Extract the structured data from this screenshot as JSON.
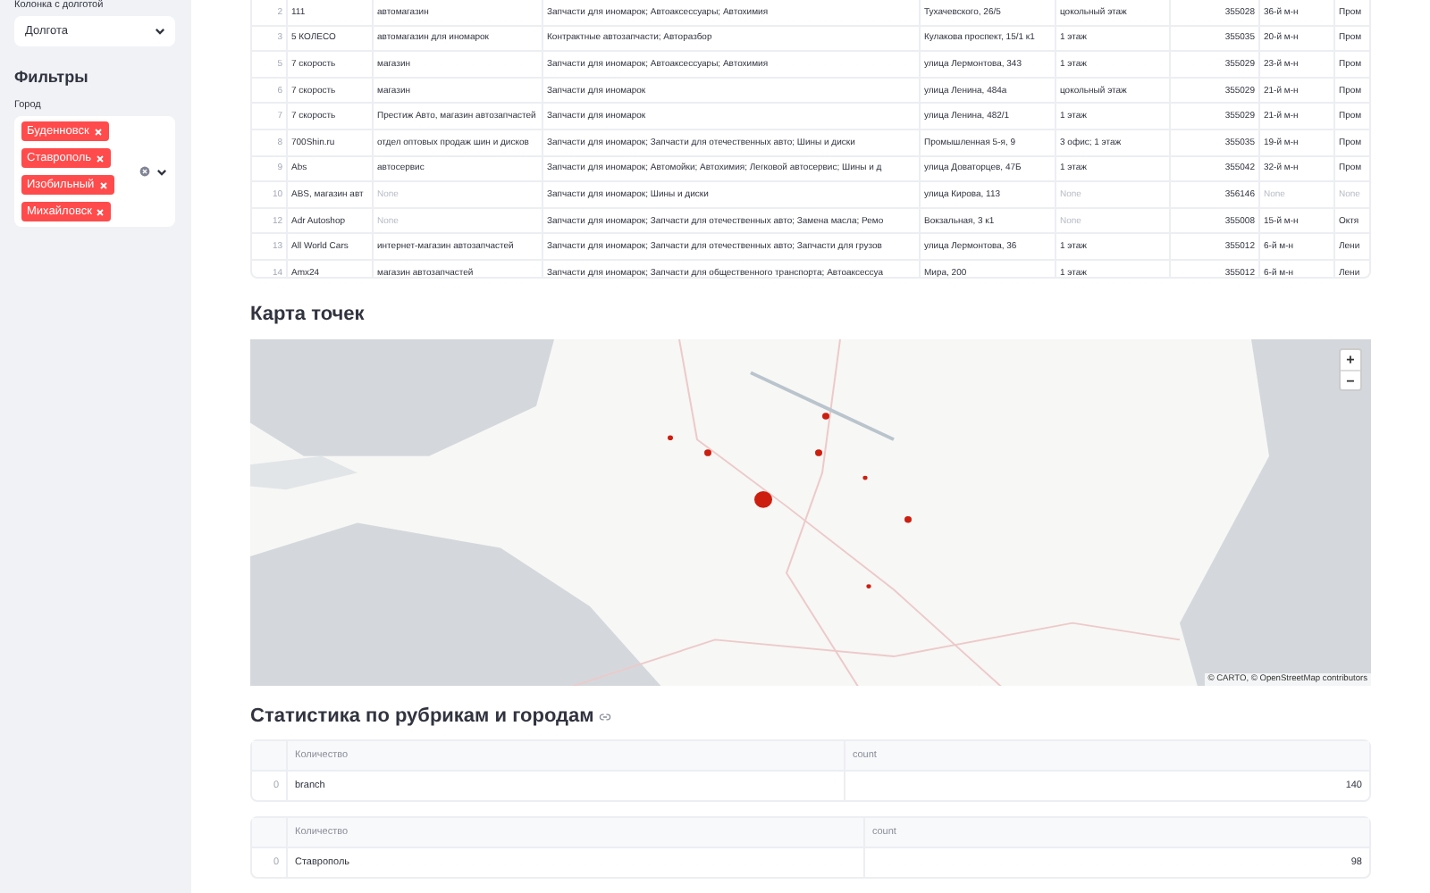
{
  "sidebar": {
    "longitude_label": "Колонка с долготой",
    "longitude_select": {
      "value": "Долгота"
    },
    "filters_title": "Фильтры",
    "city_label": "Город",
    "city_tags": [
      "Буденновск",
      "Ставрополь",
      "Изобильный",
      "Михайловск"
    ]
  },
  "table": {
    "rows": [
      {
        "index": "2",
        "cells": [
          "111",
          "автомагазин",
          "Запчасти для иномарок; Автоаксессуары; Автохимия",
          "Тухачевского, 26/5",
          "цокольный этаж",
          "355028",
          "36-й м-н",
          "Пром"
        ]
      },
      {
        "index": "3",
        "cells": [
          "5 КОЛЕСО",
          "автомагазин для иномарок",
          "Контрактные автозапчасти; Авторазбор",
          "Кулакова проспект, 15/1 к1",
          "1 этаж",
          "355035",
          "20-й м-н",
          "Пром"
        ]
      },
      {
        "index": "5",
        "cells": [
          "7 скорость",
          "магазин",
          "Запчасти для иномарок; Автоаксессуары; Автохимия",
          "улица Лермонтова, 343",
          "1 этаж",
          "355029",
          "23-й м-н",
          "Пром"
        ]
      },
      {
        "index": "6",
        "cells": [
          "7 скорость",
          "магазин",
          "Запчасти для иномарок",
          "улица Ленина, 484а",
          "цокольный этаж",
          "355029",
          "21-й м-н",
          "Пром"
        ]
      },
      {
        "index": "7",
        "cells": [
          "7 скорость",
          "Престиж Авто, магазин автозапчастей",
          "Запчасти для иномарок",
          "улица Ленина, 482/1",
          "1 этаж",
          "355029",
          "21-й м-н",
          "Пром"
        ]
      },
      {
        "index": "8",
        "cells": [
          "700Shin.ru",
          "отдел оптовых продаж шин и дисков",
          "Запчасти для иномарок; Запчасти для отечественных авто; Шины и диски",
          "Промышленная 5-я, 9",
          "3 офис; 1 этаж",
          "355035",
          "19-й м-н",
          "Пром"
        ]
      },
      {
        "index": "9",
        "cells": [
          "Abs",
          "автосервис",
          "Запчасти для иномарок; Автомойки; Автохимия; Легковой автосервис; Шины и д",
          "улица Доваторцев, 47Б",
          "1 этаж",
          "355042",
          "32-й м-н",
          "Пром"
        ]
      },
      {
        "index": "10",
        "cells": [
          "ABS, магазин авт",
          {
            "text": "None",
            "empty": true
          },
          "Запчасти для иномарок; Шины и диски",
          "улица Кирова, 113",
          {
            "text": "None",
            "empty": true
          },
          "356146",
          {
            "text": "None",
            "empty": true
          },
          {
            "text": "None",
            "empty": true
          }
        ]
      },
      {
        "index": "12",
        "cells": [
          "Adr Autoshop",
          {
            "text": "None",
            "empty": true
          },
          "Запчасти для иномарок; Запчасти для отечественных авто; Замена масла; Ремо",
          "Вокзальная, 3 к1",
          {
            "text": "None",
            "empty": true
          },
          "355008",
          "15-й м-н",
          "Октя"
        ]
      },
      {
        "index": "13",
        "cells": [
          "All World Cars",
          "интернет-магазин автозапчастей",
          "Запчасти для иномарок; Запчасти для отечественных авто; Запчасти для грузов",
          "улица Лермонтова, 36",
          "1 этаж",
          "355012",
          "6-й м-н",
          "Лени"
        ]
      },
      {
        "index": "14",
        "cells": [
          "Amx24",
          "магазин автозапчастей",
          "Запчасти для иномарок; Запчасти для общественного транспорта; Автоаксессуа",
          "Мира, 200",
          "1 этаж",
          "355012",
          "6-й м-н",
          "Лени"
        ]
      }
    ]
  },
  "map_section": {
    "title": "Карта точек",
    "map": {
      "kind": "picture",
      "zoom_in": "+",
      "zoom_out": "−",
      "attribution": "© CARTO, © OpenStreetMap contributors"
    }
  },
  "stats_section": {
    "title": "Статистика по рубрикам и городам",
    "tables": [
      {
        "columns": [
          "Количество",
          "count"
        ],
        "rows": [
          {
            "index": "0",
            "cells": [
              "branch",
              "140"
            ]
          }
        ]
      },
      {
        "columns": [
          "Количество",
          "count"
        ],
        "rows": [
          {
            "index": "0",
            "cells": [
              "Ставрополь",
              "98"
            ]
          }
        ]
      }
    ]
  }
}
